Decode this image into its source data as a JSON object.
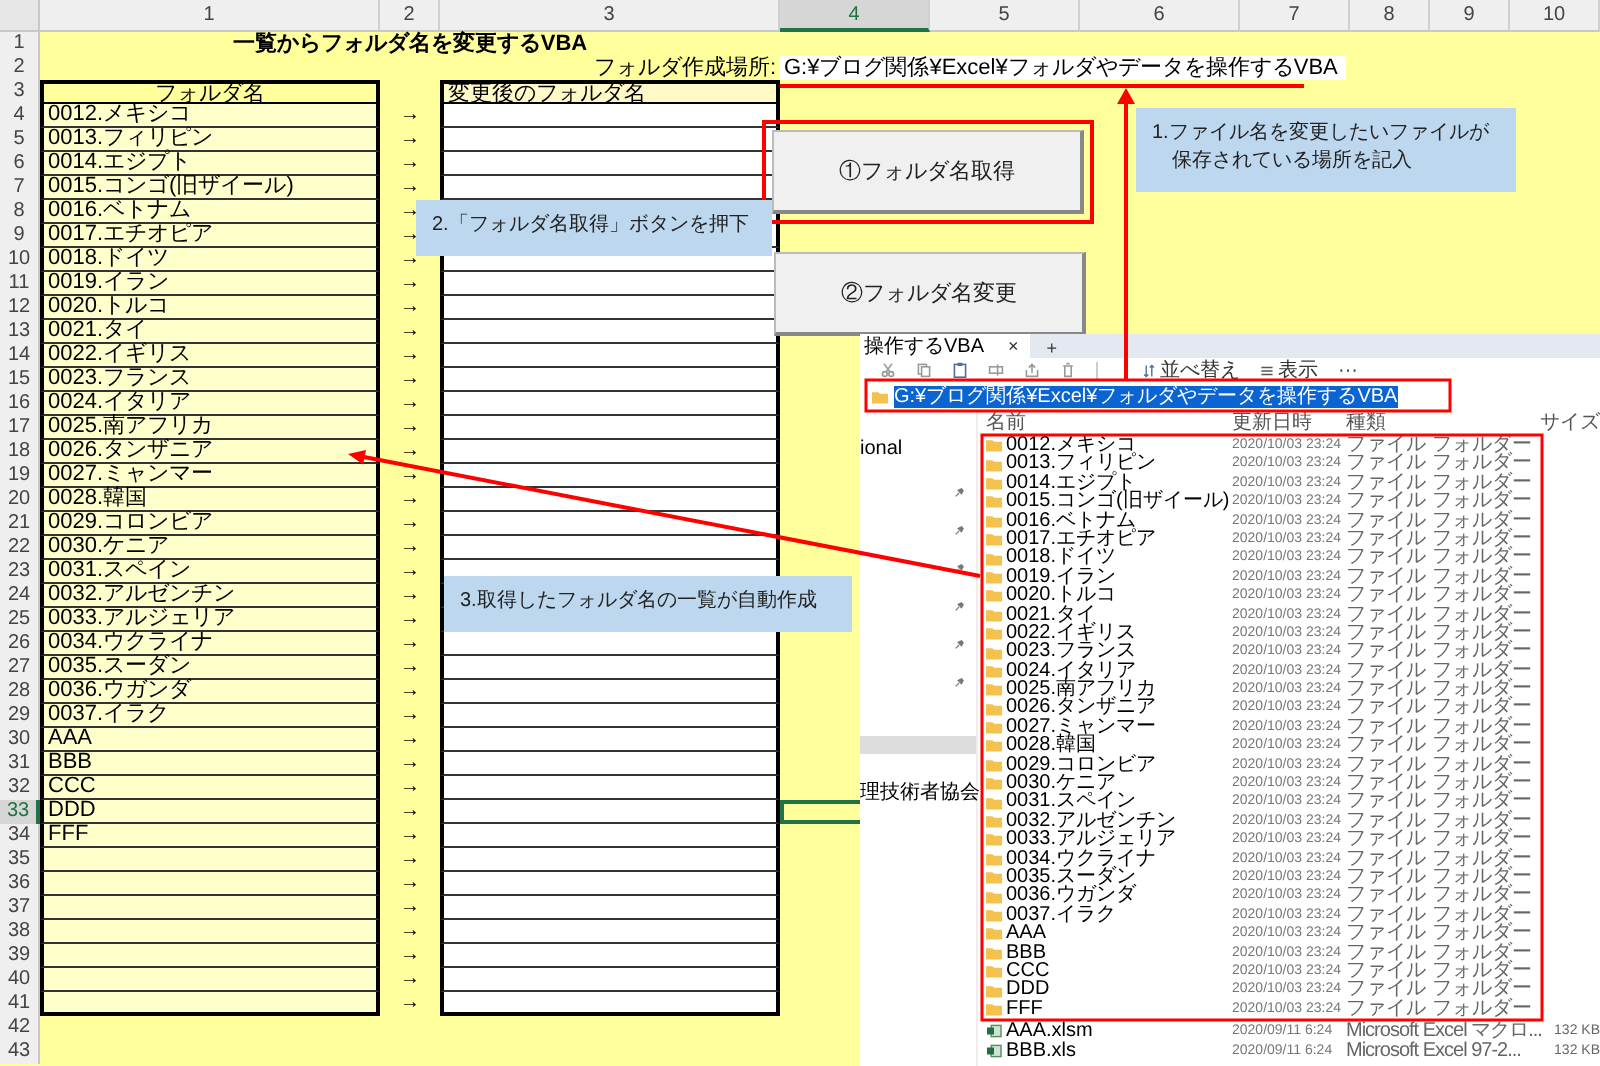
{
  "column_headers": [
    {
      "label": "1",
      "selected": false
    },
    {
      "label": "2",
      "selected": false
    },
    {
      "label": "3",
      "selected": false
    },
    {
      "label": "4",
      "selected": true
    },
    {
      "label": "5",
      "selected": false
    },
    {
      "label": "6",
      "selected": false
    },
    {
      "label": "7",
      "selected": false
    },
    {
      "label": "8",
      "selected": false
    },
    {
      "label": "9",
      "selected": false
    },
    {
      "label": "10",
      "selected": false
    }
  ],
  "row_headers": [
    {
      "label": "1",
      "selected": false
    },
    {
      "label": "2",
      "selected": false
    },
    {
      "label": "3",
      "selected": false
    },
    {
      "label": "4",
      "selected": false
    },
    {
      "label": "5",
      "selected": false
    },
    {
      "label": "6",
      "selected": false
    },
    {
      "label": "7",
      "selected": false
    },
    {
      "label": "8",
      "selected": false
    },
    {
      "label": "9",
      "selected": false
    },
    {
      "label": "10",
      "selected": false
    },
    {
      "label": "11",
      "selected": false
    },
    {
      "label": "12",
      "selected": false
    },
    {
      "label": "13",
      "selected": false
    },
    {
      "label": "14",
      "selected": false
    },
    {
      "label": "15",
      "selected": false
    },
    {
      "label": "16",
      "selected": false
    },
    {
      "label": "17",
      "selected": false
    },
    {
      "label": "18",
      "selected": false
    },
    {
      "label": "19",
      "selected": false
    },
    {
      "label": "20",
      "selected": false
    },
    {
      "label": "21",
      "selected": false
    },
    {
      "label": "22",
      "selected": false
    },
    {
      "label": "23",
      "selected": false
    },
    {
      "label": "24",
      "selected": false
    },
    {
      "label": "25",
      "selected": false
    },
    {
      "label": "26",
      "selected": false
    },
    {
      "label": "27",
      "selected": false
    },
    {
      "label": "28",
      "selected": false
    },
    {
      "label": "29",
      "selected": false
    },
    {
      "label": "30",
      "selected": false
    },
    {
      "label": "31",
      "selected": false
    },
    {
      "label": "32",
      "selected": false
    },
    {
      "label": "33",
      "selected": true
    },
    {
      "label": "34",
      "selected": false
    },
    {
      "label": "35",
      "selected": false
    },
    {
      "label": "36",
      "selected": false
    },
    {
      "label": "37",
      "selected": false
    },
    {
      "label": "38",
      "selected": false
    },
    {
      "label": "39",
      "selected": false
    },
    {
      "label": "40",
      "selected": false
    },
    {
      "label": "41",
      "selected": false
    },
    {
      "label": "42",
      "selected": false
    },
    {
      "label": "43",
      "selected": false
    }
  ],
  "title": "一覧からフォルダ名を変更するVBA",
  "location_label": "フォルダ作成場所:",
  "location_path": "G:¥ブログ関係¥Excel¥フォルダやデータを操作するVBA",
  "table": {
    "headers": [
      "フォルダ名",
      "変更後のフォルダ名"
    ],
    "rows": [
      {
        "name": "0012.メキシコ",
        "arrow": "→"
      },
      {
        "name": "0013.フィリピン",
        "arrow": "→"
      },
      {
        "name": "0014.エジプト",
        "arrow": "→"
      },
      {
        "name": "0015.コンゴ(旧ザイール)",
        "arrow": "→"
      },
      {
        "name": "0016.ベトナム",
        "arrow": "→"
      },
      {
        "name": "0017.エチオピア",
        "arrow": "→"
      },
      {
        "name": "0018.ドイツ",
        "arrow": "→"
      },
      {
        "name": "0019.イラン",
        "arrow": "→"
      },
      {
        "name": "0020.トルコ",
        "arrow": "→"
      },
      {
        "name": "0021.タイ",
        "arrow": "→"
      },
      {
        "name": "0022.イギリス",
        "arrow": "→"
      },
      {
        "name": "0023.フランス",
        "arrow": "→"
      },
      {
        "name": "0024.イタリア",
        "arrow": "→"
      },
      {
        "name": "0025.南アフリカ",
        "arrow": "→"
      },
      {
        "name": "0026.タンザニア",
        "arrow": "→"
      },
      {
        "name": "0027.ミャンマー",
        "arrow": "→"
      },
      {
        "name": "0028.韓国",
        "arrow": "→"
      },
      {
        "name": "0029.コロンビア",
        "arrow": "→"
      },
      {
        "name": "0030.ケニア",
        "arrow": "→"
      },
      {
        "name": "0031.スペイン",
        "arrow": "→"
      },
      {
        "name": "0032.アルゼンチン",
        "arrow": "→"
      },
      {
        "name": "0033.アルジェリア",
        "arrow": "→"
      },
      {
        "name": "0034.ウクライナ",
        "arrow": "→"
      },
      {
        "name": "0035.スーダン",
        "arrow": "→"
      },
      {
        "name": "0036.ウガンダ",
        "arrow": "→"
      },
      {
        "name": "0037.イラク",
        "arrow": "→"
      },
      {
        "name": "AAA",
        "arrow": "→"
      },
      {
        "name": "BBB",
        "arrow": "→"
      },
      {
        "name": "CCC",
        "arrow": "→"
      },
      {
        "name": "DDD",
        "arrow": "→"
      },
      {
        "name": "FFF",
        "arrow": "→"
      },
      {
        "arrow": "→"
      },
      {
        "arrow": "→"
      },
      {
        "arrow": "→"
      },
      {
        "arrow": "→"
      },
      {
        "arrow": "→"
      },
      {
        "arrow": "→"
      },
      {
        "arrow": "→"
      }
    ]
  },
  "buttons": [
    {
      "label": "①フォルダ名取得",
      "framed": true
    },
    {
      "label": "②フォルダ名変更",
      "framed": false
    }
  ],
  "callouts": [
    {
      "lines": [
        "1.ファイル名を変更したいファイルが",
        "保存されている場所を記入"
      ]
    },
    {
      "lines": [
        "2.「フォルダ名取得」ボタンを押下"
      ]
    },
    {
      "lines": [
        "3.取得したフォルダ名の一覧が自動作成"
      ]
    }
  ],
  "explorer": {
    "tab_title": "操作するVBA",
    "tab_close": "×",
    "new_tab": "+",
    "toolbar": {
      "sort": "並べ替え",
      "view": "表示",
      "more": "···"
    },
    "address": "G:¥ブログ関係¥Excel¥フォルダやデータを操作するVBA",
    "nav_items": [
      "ional",
      "理技術者協会"
    ],
    "columns": [
      "名前",
      "更新日時",
      "種類",
      "サイズ"
    ],
    "files": [
      {
        "kind": "folder",
        "name": "0012.メキシコ",
        "date": "2020/10/03 23:24",
        "type": "ファイル フォルダー"
      },
      {
        "kind": "folder",
        "name": "0013.フィリピン",
        "date": "2020/10/03 23:24",
        "type": "ファイル フォルダー"
      },
      {
        "kind": "folder",
        "name": "0014.エジプト",
        "date": "2020/10/03 23:24",
        "type": "ファイル フォルダー"
      },
      {
        "kind": "folder",
        "name": "0015.コンゴ(旧ザイール)",
        "date": "2020/10/03 23:24",
        "type": "ファイル フォルダー"
      },
      {
        "kind": "folder",
        "name": "0016.ベトナム",
        "date": "2020/10/03 23:24",
        "type": "ファイル フォルダー"
      },
      {
        "kind": "folder",
        "name": "0017.エチオピア",
        "date": "2020/10/03 23:24",
        "type": "ファイル フォルダー"
      },
      {
        "kind": "folder",
        "name": "0018.ドイツ",
        "date": "2020/10/03 23:24",
        "type": "ファイル フォルダー"
      },
      {
        "kind": "folder",
        "name": "0019.イラン",
        "date": "2020/10/03 23:24",
        "type": "ファイル フォルダー"
      },
      {
        "kind": "folder",
        "name": "0020.トルコ",
        "date": "2020/10/03 23:24",
        "type": "ファイル フォルダー"
      },
      {
        "kind": "folder",
        "name": "0021.タイ",
        "date": "2020/10/03 23:24",
        "type": "ファイル フォルダー"
      },
      {
        "kind": "folder",
        "name": "0022.イギリス",
        "date": "2020/10/03 23:24",
        "type": "ファイル フォルダー"
      },
      {
        "kind": "folder",
        "name": "0023.フランス",
        "date": "2020/10/03 23:24",
        "type": "ファイル フォルダー"
      },
      {
        "kind": "folder",
        "name": "0024.イタリア",
        "date": "2020/10/03 23:24",
        "type": "ファイル フォルダー"
      },
      {
        "kind": "folder",
        "name": "0025.南アフリカ",
        "date": "2020/10/03 23:24",
        "type": "ファイル フォルダー"
      },
      {
        "kind": "folder",
        "name": "0026.タンザニア",
        "date": "2020/10/03 23:24",
        "type": "ファイル フォルダー"
      },
      {
        "kind": "folder",
        "name": "0027.ミャンマー",
        "date": "2020/10/03 23:24",
        "type": "ファイル フォルダー"
      },
      {
        "kind": "folder",
        "name": "0028.韓国",
        "date": "2020/10/03 23:24",
        "type": "ファイル フォルダー"
      },
      {
        "kind": "folder",
        "name": "0029.コロンビア",
        "date": "2020/10/03 23:24",
        "type": "ファイル フォルダー"
      },
      {
        "kind": "folder",
        "name": "0030.ケニア",
        "date": "2020/10/03 23:24",
        "type": "ファイル フォルダー"
      },
      {
        "kind": "folder",
        "name": "0031.スペイン",
        "date": "2020/10/03 23:24",
        "type": "ファイル フォルダー"
      },
      {
        "kind": "folder",
        "name": "0032.アルゼンチン",
        "date": "2020/10/03 23:24",
        "type": "ファイル フォルダー"
      },
      {
        "kind": "folder",
        "name": "0033.アルジェリア",
        "date": "2020/10/03 23:24",
        "type": "ファイル フォルダー"
      },
      {
        "kind": "folder",
        "name": "0034.ウクライナ",
        "date": "2020/10/03 23:24",
        "type": "ファイル フォルダー"
      },
      {
        "kind": "folder",
        "name": "0035.スーダン",
        "date": "2020/10/03 23:24",
        "type": "ファイル フォルダー"
      },
      {
        "kind": "folder",
        "name": "0036.ウガンダ",
        "date": "2020/10/03 23:24",
        "type": "ファイル フォルダー"
      },
      {
        "kind": "folder",
        "name": "0037.イラク",
        "date": "2020/10/03 23:24",
        "type": "ファイル フォルダー"
      },
      {
        "kind": "folder",
        "name": "AAA",
        "date": "2020/10/03 23:24",
        "type": "ファイル フォルダー"
      },
      {
        "kind": "folder",
        "name": "BBB",
        "date": "2020/10/03 23:24",
        "type": "ファイル フォルダー"
      },
      {
        "kind": "folder",
        "name": "CCC",
        "date": "2020/10/03 23:24",
        "type": "ファイル フォルダー"
      },
      {
        "kind": "folder",
        "name": "DDD",
        "date": "2020/10/03 23:24",
        "type": "ファイル フォルダー"
      },
      {
        "kind": "folder",
        "name": "FFF",
        "date": "2020/10/03 23:24",
        "type": "ファイル フォルダー"
      },
      {
        "kind": "excel",
        "name": "AAA.xlsm",
        "date": "2020/09/11 6:24",
        "type": "Microsoft Excel マクロ...",
        "size": "132 KB"
      },
      {
        "kind": "excel",
        "name": "BBB.xls",
        "date": "2020/09/11 6:24",
        "type": "Microsoft Excel 97-2...",
        "size": "132 KB"
      }
    ]
  }
}
